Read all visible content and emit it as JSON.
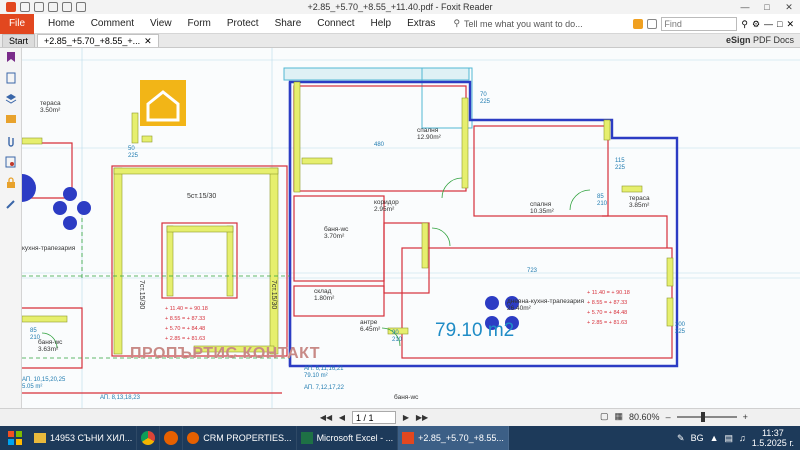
{
  "window": {
    "title": "+2.85_+5.70_+8.55_+11.40.pdf - Foxit Reader"
  },
  "ribbon": {
    "file_label": "File",
    "menu": [
      "Home",
      "Comment",
      "View",
      "Form",
      "Protect",
      "Share",
      "Connect",
      "Help",
      "Extras"
    ],
    "tell_me": "Tell me what you want to do...",
    "find_placeholder": "Find"
  },
  "tabs": [
    {
      "label": "Start",
      "active": false
    },
    {
      "label": "+2.85_+5.70_+8.55_+...",
      "active": true
    }
  ],
  "esign": {
    "bold": "eSign",
    "rest": " PDF Docs"
  },
  "status": {
    "page": "1 / 1",
    "zoom": "80.60%"
  },
  "plan": {
    "area_big": "79.10 m2",
    "watermark": "ПРОПЪРТИС КОНТАКТ",
    "rooms": {
      "spalnya1": "спалня",
      "spalnya1_area": "12.90m²",
      "spalnya2": "спалня",
      "spalnya2_area": "10.35m²",
      "koridor": "коридор",
      "koridor_area": "2.95m²",
      "banya": "баня-wc",
      "banya_area": "3.70m²",
      "sklad": "склад",
      "sklad_area": "1.80m²",
      "antre": "антре",
      "antre_area": "6.45m²",
      "dnevna": "дневна-кухня-трапезария",
      "dnevna_area": "26.40m²",
      "terasa_r": "тераса",
      "terasa_r_area": "3.85m²",
      "terasa_l": "тераса",
      "terasa_l_area": "3.50m²",
      "kuhnya_l": "кухня-трапезария",
      "banya_l": "баня-wc",
      "banya_l_area": "3.63m²",
      "banya_b": "баня-wc",
      "stair1": "5ст.15/30",
      "stair2": "7ст.15/30",
      "ap_a": "АП. 6,11,16,21",
      "ap_a_area": "79.10 m²",
      "ap_b": "АП. 7,12,17,22",
      "ap_c": "АП. 8,13,18,23",
      "ap_d": "АП. 10,15,20,25",
      "ap_d_area": "5.05 m²"
    },
    "levels_a": [
      "+ 11.40 = + 90.18",
      "+ 8.55 = + 87.33",
      "+ 5.70 = + 84.48",
      "+ 2.85 = + 81.63"
    ],
    "levels_b": [
      "+ 11.40 = + 90.18",
      "+ 8.55 = + 87.33",
      "+ 5.70 = + 84.48",
      "+ 2.85 = + 81.63"
    ],
    "dims": {
      "d480": "480",
      "d723": "723",
      "d70": "70",
      "d225": "225",
      "d200": "200",
      "d85": "85",
      "d210": "210",
      "d90": "90",
      "d50": "50",
      "d115": "115"
    }
  },
  "taskbar": {
    "items": [
      {
        "label": "14953 СЪНИ ХИЛ...",
        "active": false
      },
      {
        "label": "",
        "active": false
      },
      {
        "label": "",
        "active": false
      },
      {
        "label": "CRM PROPERTIES...",
        "active": false
      },
      {
        "label": "Microsoft Excel - ...",
        "active": false
      },
      {
        "label": "+2.85_+5.70_+8.55...",
        "active": true
      }
    ],
    "lang": "BG",
    "time": "11:37",
    "date": "1.5.2025 г."
  }
}
